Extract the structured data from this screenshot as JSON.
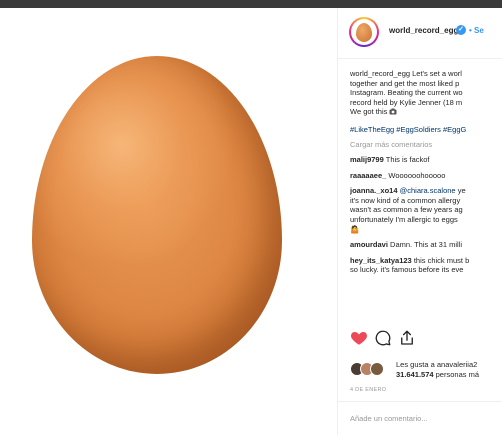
{
  "colors": {
    "accent": "#3897f0",
    "like_red": "#ed4956",
    "hashtag": "#003569",
    "muted": "#999999"
  },
  "post": {
    "username": "world_record_egg",
    "verified_icon": "verified-badge-icon",
    "follow_separator_label": "• Se"
  },
  "caption": {
    "lines": [
      "world_record_egg Let's set a worl",
      "together and get the most liked p",
      "Instagram. Beating the current wo",
      "record held by Kylie Jenner (18 m",
      "We got this"
    ],
    "emoji_icon": "camera-icon"
  },
  "hashtags": "#LikeTheEgg #EggSoldiers #EggG",
  "load_more": "Cargar más comentarios",
  "comments": [
    {
      "user": "malij9799",
      "text": "This is fackof"
    },
    {
      "user": "raaaaaee_",
      "text": "Woooooohooooo"
    },
    {
      "user": "joanna._xo14",
      "mention": "@chiara.scalone",
      "text_after_mention": "ye",
      "more_lines": [
        "it's now kind of a common allergy",
        "wasn't as common a few years ag",
        "unfortunately I'm allergic to eggs",
        "🤷"
      ]
    },
    {
      "user": "amourdavi",
      "text": "Damn. This at 31 milli"
    },
    {
      "user": "hey_its_katya123",
      "text": "this chick must b",
      "more_lines": [
        "so lucky. it's famous before its eve"
      ]
    }
  ],
  "actions": {
    "like_icon": "heart-icon",
    "comment_icon": "comment-icon",
    "share_icon": "share-icon"
  },
  "likes": {
    "line1": "Les gusta a anavaleriia2",
    "count": "31.641.574",
    "line2_suffix": "personas má"
  },
  "date": "4 DE ENERO",
  "add_comment_placeholder": "Añade un comentario..."
}
